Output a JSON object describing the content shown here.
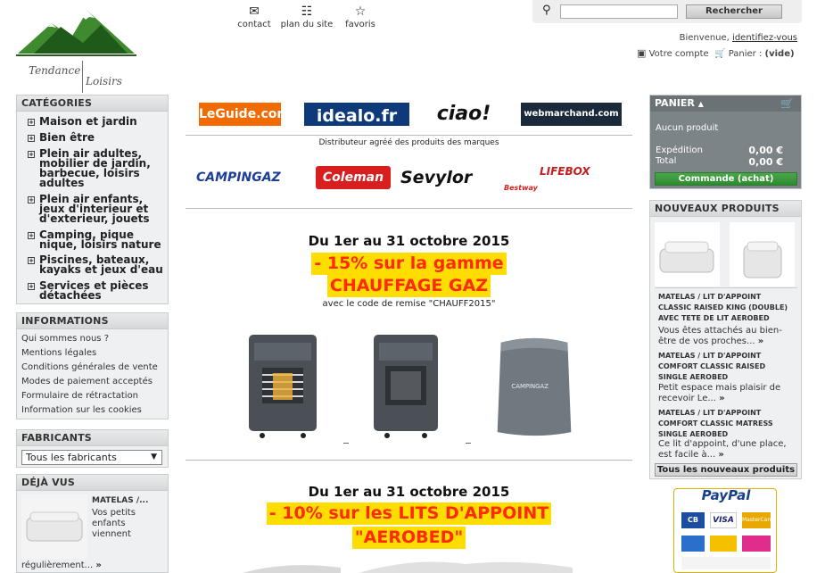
{
  "logo": {
    "line1": "Tendance",
    "line2": "Loisirs"
  },
  "toplinks": [
    {
      "label": "contact",
      "icon": "envelope-icon"
    },
    {
      "label": "plan du site",
      "icon": "sitemap-icon"
    },
    {
      "label": "favoris",
      "icon": "star-icon"
    }
  ],
  "search": {
    "placeholder": "",
    "button_label": "Rechercher"
  },
  "welcome": {
    "text": "Bienvenue,",
    "link": "identifiez-vous"
  },
  "account": {
    "account_label": "Votre compte",
    "cart_label": "Panier :",
    "cart_state": "(vide)"
  },
  "categories": {
    "title": "CATÉGORIES",
    "items": [
      "Maison et jardin",
      "Bien être",
      "Plein air adultes, mobilier de jardin, barbecue, loisirs adultes",
      "Plein air enfants, jeux d'interieur et d'exterieur, jouets",
      "Camping, pique nique, loisirs nature",
      "Piscines, bateaux, kayaks et jeux d'eau",
      "Services et pièces détachées"
    ]
  },
  "informations": {
    "title": "INFORMATIONS",
    "items": [
      "Qui sommes nous ?",
      "Mentions légales",
      "Conditions générales de vente",
      "Modes de paiement acceptés",
      "Formulaire de rétractation",
      "Information sur les cookies"
    ]
  },
  "fabricants": {
    "title": "FABRICANTS",
    "selected": "Tous les fabricants"
  },
  "deja_vus": {
    "title": "DÉJÀ VUS",
    "product_name": "MATELAS /...",
    "desc": "Vos petits enfants viennent",
    "more": "régulièrement..."
  },
  "partners": [
    "LeGuide.com",
    "idealo.fr",
    "ciao!",
    "webmarchand.com"
  ],
  "distributor_text": "Distributeur agréé des produits des marques",
  "brands": [
    "CAMPINGAZ",
    "Coleman",
    "Sevylor",
    "Bestway",
    "LIFEBOX"
  ],
  "promo1": {
    "date": "Du 1er au 31 octobre 2015",
    "line1": "- 15% sur la gamme",
    "line2": "CHAUFFAGE GAZ",
    "code": "avec le code de remise \"CHAUFF2015\""
  },
  "promo2": {
    "date": "Du 1er au 31 octobre 2015",
    "line1": "- 10% sur les LITS D'APPOINT",
    "line2": "\"AEROBED\""
  },
  "cart": {
    "title": "PANIER",
    "empty": "Aucun produit",
    "shipping_label": "Expédition",
    "shipping_value": "0,00 €",
    "total_label": "Total",
    "total_value": "0,00 €",
    "order_button": "Commande (achat)"
  },
  "new_products": {
    "title": "NOUVEAUX PRODUITS",
    "items": [
      {
        "title": "MATELAS / LIT D'APPOINT CLASSIC RAISED KING (DOUBLE) AVEC TETE DE LIT AEROBED",
        "desc": "Vous êtes attachés au bien-être de vos proches..."
      },
      {
        "title": "MATELAS / LIT D'APPOINT COMFORT CLASSIC RAISED SINGLE AEROBED",
        "desc": "Petit espace mais plaisir de recevoir Le..."
      },
      {
        "title": "MATELAS / LIT D'APPOINT COMFORT CLASSIC MATRESS SINGLE AEROBED",
        "desc": "Ce lit d'appoint, d'une place, est facile à..."
      }
    ],
    "all_button": "Tous les nouveaux produits"
  },
  "paypal": {
    "title": "PayPal",
    "cards": [
      "CB",
      "VISA",
      "MasterCard"
    ]
  }
}
